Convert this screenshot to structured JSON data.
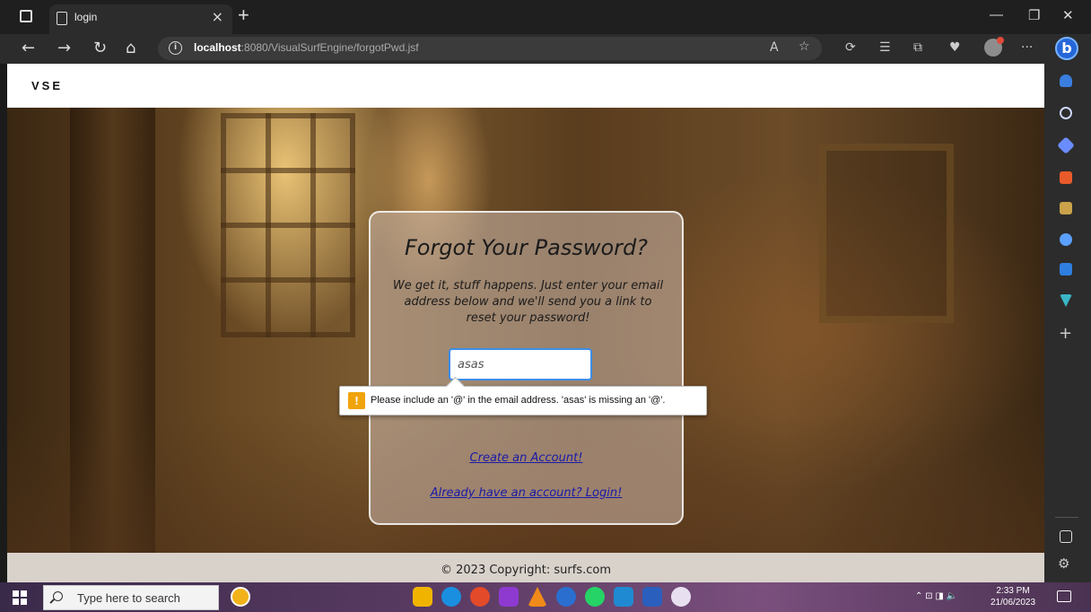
{
  "browser": {
    "tab_title": "login",
    "tab_close": "×",
    "new_tab": "+",
    "url_host": "localhost",
    "url_rest": ":8080/VisualSurfEngine/forgotPwd.jsf"
  },
  "site": {
    "brand": "VSE",
    "card": {
      "title": "Forgot Your Password?",
      "description": "We get it, stuff happens. Just enter your email address below and we'll send you a link to reset your password!",
      "email_value": "asas",
      "create_account_link": "Create an Account!",
      "login_link": "Already have an account? Login!"
    },
    "validation_tooltip": "Please include an '@' in the email address. 'asas' is missing an '@'.",
    "footer": "© 2023 Copyright: surfs.com"
  },
  "taskbar": {
    "search_placeholder": "Type here to search",
    "time": "2:33 PM",
    "date": "21/06/2023"
  }
}
